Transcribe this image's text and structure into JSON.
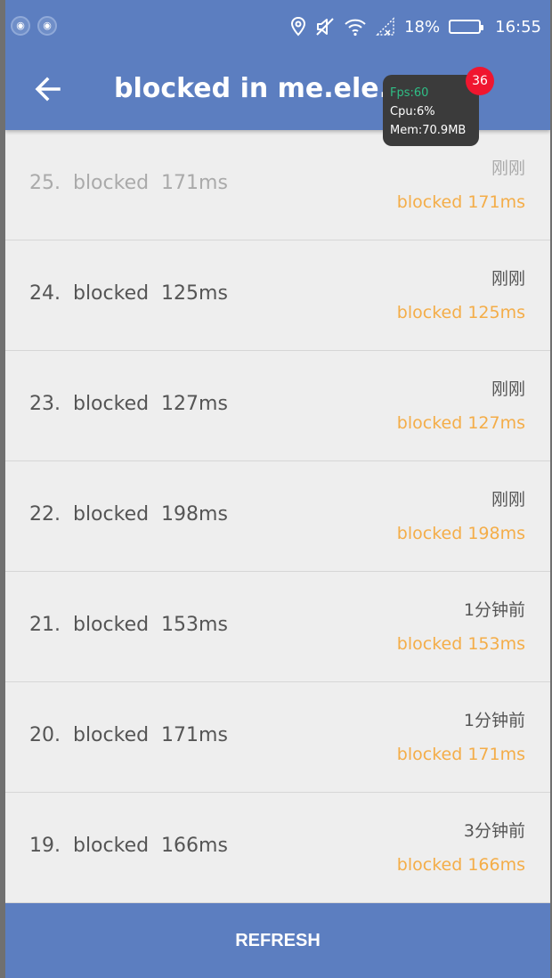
{
  "status_bar": {
    "battery": "18%",
    "clock": "16:55",
    "icons": [
      "android-debug-icon",
      "android-debug-icon",
      "location-icon",
      "mute-icon",
      "wifi-icon",
      "signal-icon",
      "battery-icon"
    ]
  },
  "toolbar": {
    "title": "blocked in me.ele.hb"
  },
  "perf_overlay": {
    "fps": "Fps:60",
    "cpu": "Cpu:6%",
    "mem": "Mem:70.9MB",
    "badge": "36"
  },
  "rows": [
    {
      "label": "25.  blocked  171ms",
      "time": "刚刚",
      "duration": "blocked 171ms"
    },
    {
      "label": "24.  blocked  125ms",
      "time": "刚刚",
      "duration": "blocked 125ms"
    },
    {
      "label": "23.  blocked  127ms",
      "time": "刚刚",
      "duration": "blocked 127ms"
    },
    {
      "label": "22.  blocked  198ms",
      "time": "刚刚",
      "duration": "blocked 198ms"
    },
    {
      "label": "21.  blocked  153ms",
      "time": "1分钟前",
      "duration": "blocked 153ms"
    },
    {
      "label": "20.  blocked  171ms",
      "time": "1分钟前",
      "duration": "blocked 171ms"
    },
    {
      "label": "19.  blocked  166ms",
      "time": "3分钟前",
      "duration": "blocked 166ms"
    }
  ],
  "refresh_label": "REFRESH",
  "colors": {
    "app_bar": "#5c7ec0",
    "duration_text": "#f4ad48",
    "badge": "#f0162f",
    "fps_text": "#2fbf86"
  }
}
